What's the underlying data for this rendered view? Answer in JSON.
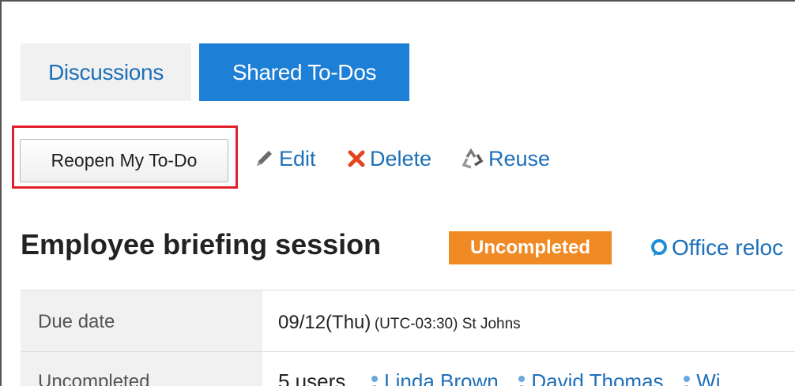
{
  "tabs": [
    {
      "label": "Discussions",
      "active": false
    },
    {
      "label": "Shared To-Dos",
      "active": true
    }
  ],
  "toolbar": {
    "reopen_label": "Reopen My To-Do",
    "edit_label": "Edit",
    "delete_label": "Delete",
    "reuse_label": "Reuse"
  },
  "todo": {
    "title": "Employee briefing session",
    "status_badge": "Uncompleted",
    "category_label": "Office reloc"
  },
  "details": {
    "due_date": {
      "label": "Due date",
      "value": "09/12(Thu)",
      "timezone": "(UTC-03:30) St Johns"
    },
    "uncompleted": {
      "label": "Uncompleted",
      "count": "5 users",
      "users": [
        "Linda Brown",
        "David Thomas",
        "Wi"
      ]
    }
  },
  "colors": {
    "accent": "#1e7fd6",
    "link": "#1d6fb8",
    "badge_orange": "#f08a24",
    "highlight_red": "#e0202b"
  },
  "icons": {
    "edit": "pencil-icon",
    "delete": "x-icon",
    "reuse": "recycle-icon",
    "category": "speech-bubble-icon",
    "user": "person-icon"
  }
}
